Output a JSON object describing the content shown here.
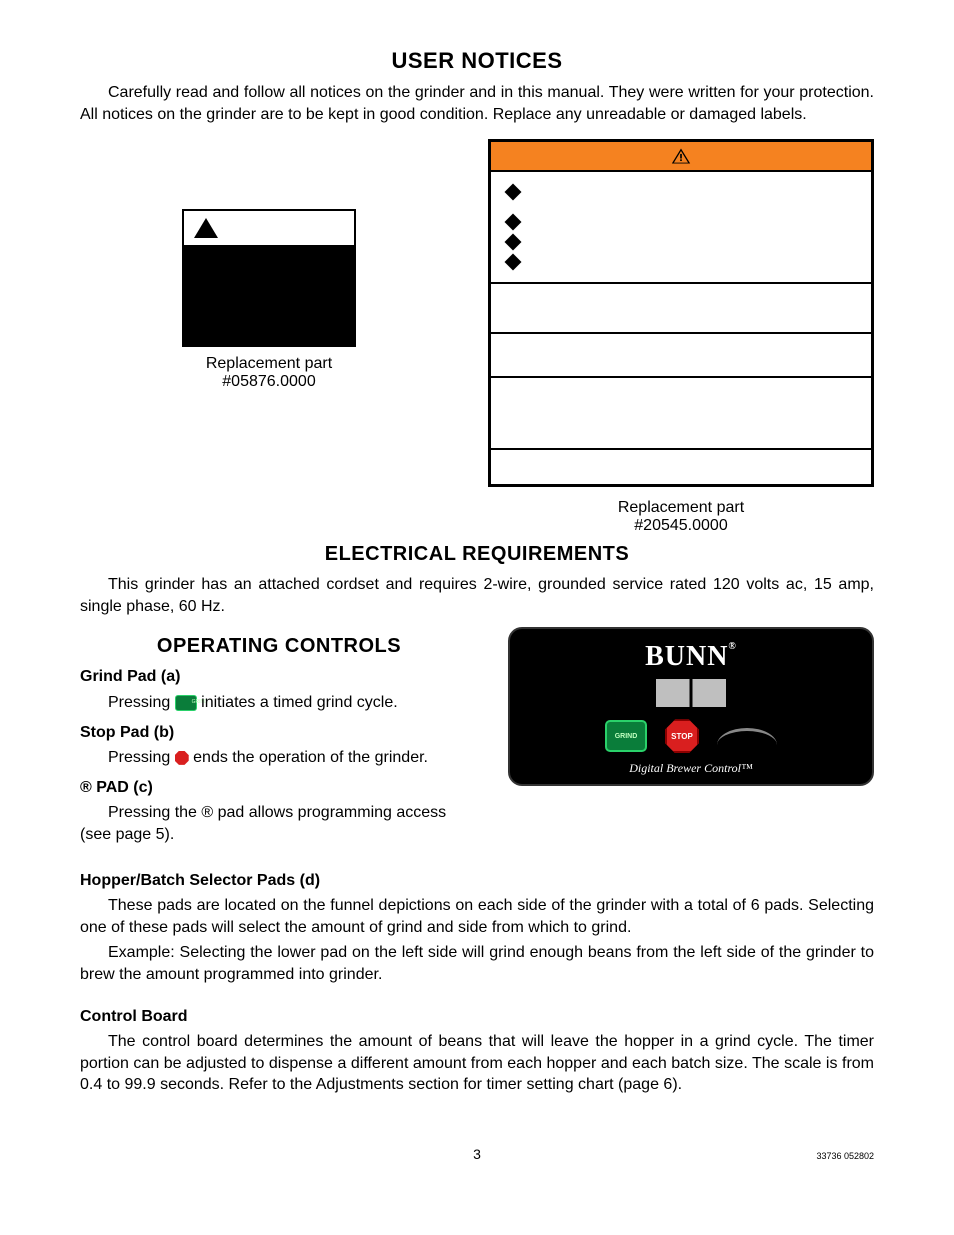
{
  "headings": {
    "user_notices": "USER NOTICES",
    "electrical": "ELECTRICAL REQUIREMENTS",
    "operating": "OPERATING CONTROLS"
  },
  "notices_intro": "Carefully read and follow all notices on the grinder and in this manual.  They were written for your protection.  All notices on the grinder are to be kept in good condition.  Replace any unreadable or damaged labels.",
  "replacement1_a": "Replacement part",
  "replacement1_b": "#05876.0000",
  "replacement2_a": "Replacement part",
  "replacement2_b": "#20545.0000",
  "electrical_text": "This grinder has an attached cordset and requires 2-wire, grounded service rated 120 volts ac, 15 amp, single phase, 60 Hz.",
  "controls": {
    "grind_h": "Grind Pad (a)",
    "grind_t1": "Pressing ",
    "grind_t2": " initiates a timed grind cycle.",
    "stop_h": "Stop Pad (b)",
    "stop_t1": "Pressing ",
    "stop_t2": " ends the operation of the grinder.",
    "reg_h": "® PAD (c)",
    "reg_t": "Pressing the ® pad allows programming access (see page 5).",
    "hopper_h": "Hopper/Batch Selector Pads (d)",
    "hopper_t1": "These pads are located on the funnel depictions on each side of the grinder with a total of 6 pads.  Selecting one of these pads will select the amount of grind and side from which to grind.",
    "hopper_t2": "Example:  Selecting the lower pad on the left side will grind enough beans from the left side of the grinder to brew the amount programmed into grinder.",
    "board_h": "Control Board",
    "board_t": "The control board determines the amount of beans that will leave the hopper in a grind cycle. The timer portion can be adjusted to dispense a different amount from each hopper and each batch size. The scale is from 0.4 to 99.9 seconds.  Refer to the Adjustments section for timer setting chart (page 6)."
  },
  "panel": {
    "brand": "BUNN",
    "reg": "®",
    "grind": "GRIND",
    "stop": "STOP",
    "tag": "Digital Brewer Control™"
  },
  "footer": {
    "page": "3",
    "code": "33736 052802"
  }
}
